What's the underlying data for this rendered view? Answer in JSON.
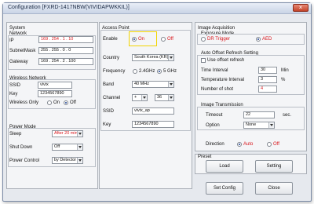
{
  "window": {
    "title": "Configuration [FXRD-1417NBW(VIVIDAPWKKIL)]",
    "close_icon": "close-icon"
  },
  "system": {
    "heading": "System",
    "network": {
      "heading": "Network",
      "ip_label": "IP",
      "ip": [
        "169",
        "254",
        "1",
        "10"
      ],
      "subnet_label": "SubnetMask",
      "subnet": [
        "255",
        "255",
        "0",
        "0"
      ],
      "gateway_label": "Gateway",
      "gateway": [
        "169",
        "254",
        "2",
        "100"
      ]
    },
    "wireless": {
      "heading": "Wireless Network",
      "ssid_label": "SSID",
      "ssid": "vivix",
      "key_label": "Key",
      "key": "1234567890",
      "wireless_only_label": "Wireless Only",
      "on": "On",
      "off": "Off"
    },
    "power": {
      "heading": "Power Mode",
      "sleep_label": "Sleep",
      "sleep": "After 20 min",
      "shutdown_label": "Shut Down",
      "shutdown": "Off",
      "control_label": "Power Control",
      "control": "by Detector"
    }
  },
  "ap": {
    "heading": "Access Point",
    "enable_label": "Enable",
    "on": "On",
    "off": "Off",
    "country_label": "Country",
    "country": "South Korea (KR)",
    "frequency_label": "Frequency",
    "f24": "2.4GHz",
    "f5": "5 GHz",
    "band_label": "Band",
    "band": "40 MHz",
    "channel_label": "Channel",
    "channel_a": "+",
    "channel_b": "36",
    "ssid_label": "SSID",
    "ssid": "vivix_ap",
    "key_label": "Key",
    "key": "1234567890"
  },
  "acq": {
    "heading": "Image Acquisition",
    "exposure_label": "Exposure Mode",
    "dr": "DR Trigger",
    "aed": "AED",
    "offset": {
      "heading": "Auto Offset Refresh Setting",
      "use_label": "Use offset refresh",
      "interval_label": "Time Interval",
      "interval": "30",
      "interval_unit": "Min",
      "temp_label": "Temperature Interval",
      "temp": "3",
      "temp_unit": "%",
      "shots_label": "Number of shot",
      "shots": "4"
    }
  },
  "transmission": {
    "heading": "Image Transmission",
    "timeout_label": "Timeout",
    "timeout": "22",
    "timeout_unit": "sec.",
    "option_label": "Option",
    "option": "None"
  },
  "direction": {
    "label": "Direction",
    "auto": "Auto",
    "off": "Off"
  },
  "preset": {
    "heading": "Preset",
    "load": "Load",
    "setting": "Setting"
  },
  "actions": {
    "set_config": "Set Config",
    "close": "Close"
  }
}
